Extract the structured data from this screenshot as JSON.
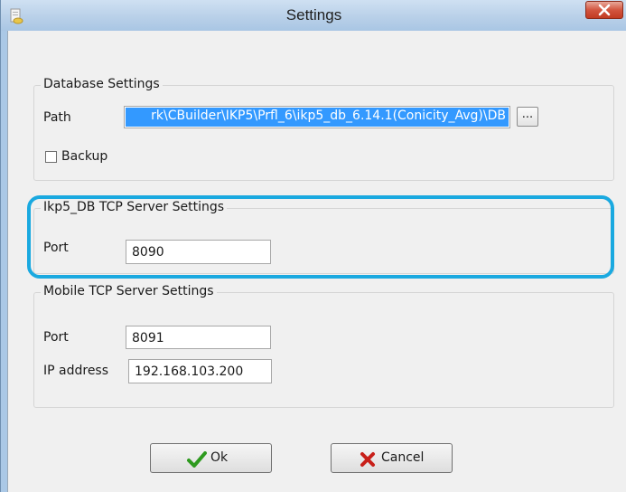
{
  "window": {
    "title": "Settings",
    "close_icon": "close-x-icon"
  },
  "database_settings": {
    "legend": "Database Settings",
    "path_label": "Path",
    "path_value": "rk\\CBuilder\\IKP5\\Prfl_6\\ikp5_db_6.14.1(Conicity_Avg)\\DB",
    "browse_label": "...",
    "backup_label": "Backup",
    "backup_checked": false
  },
  "db_tcp_server": {
    "legend": "Ikp5_DB TCP Server Settings",
    "port_label": "Port",
    "port_value": "8090",
    "highlight_color": "#1aa9e0"
  },
  "mobile_tcp_server": {
    "legend": "Mobile TCP Server Settings",
    "port_label": "Port",
    "port_value": "8091",
    "ip_label": "IP address",
    "ip_value": "192.168.103.200"
  },
  "buttons": {
    "ok_label": "Ok",
    "ok_icon": "checkmark-icon",
    "cancel_label": "Cancel",
    "cancel_icon": "red-x-icon"
  }
}
